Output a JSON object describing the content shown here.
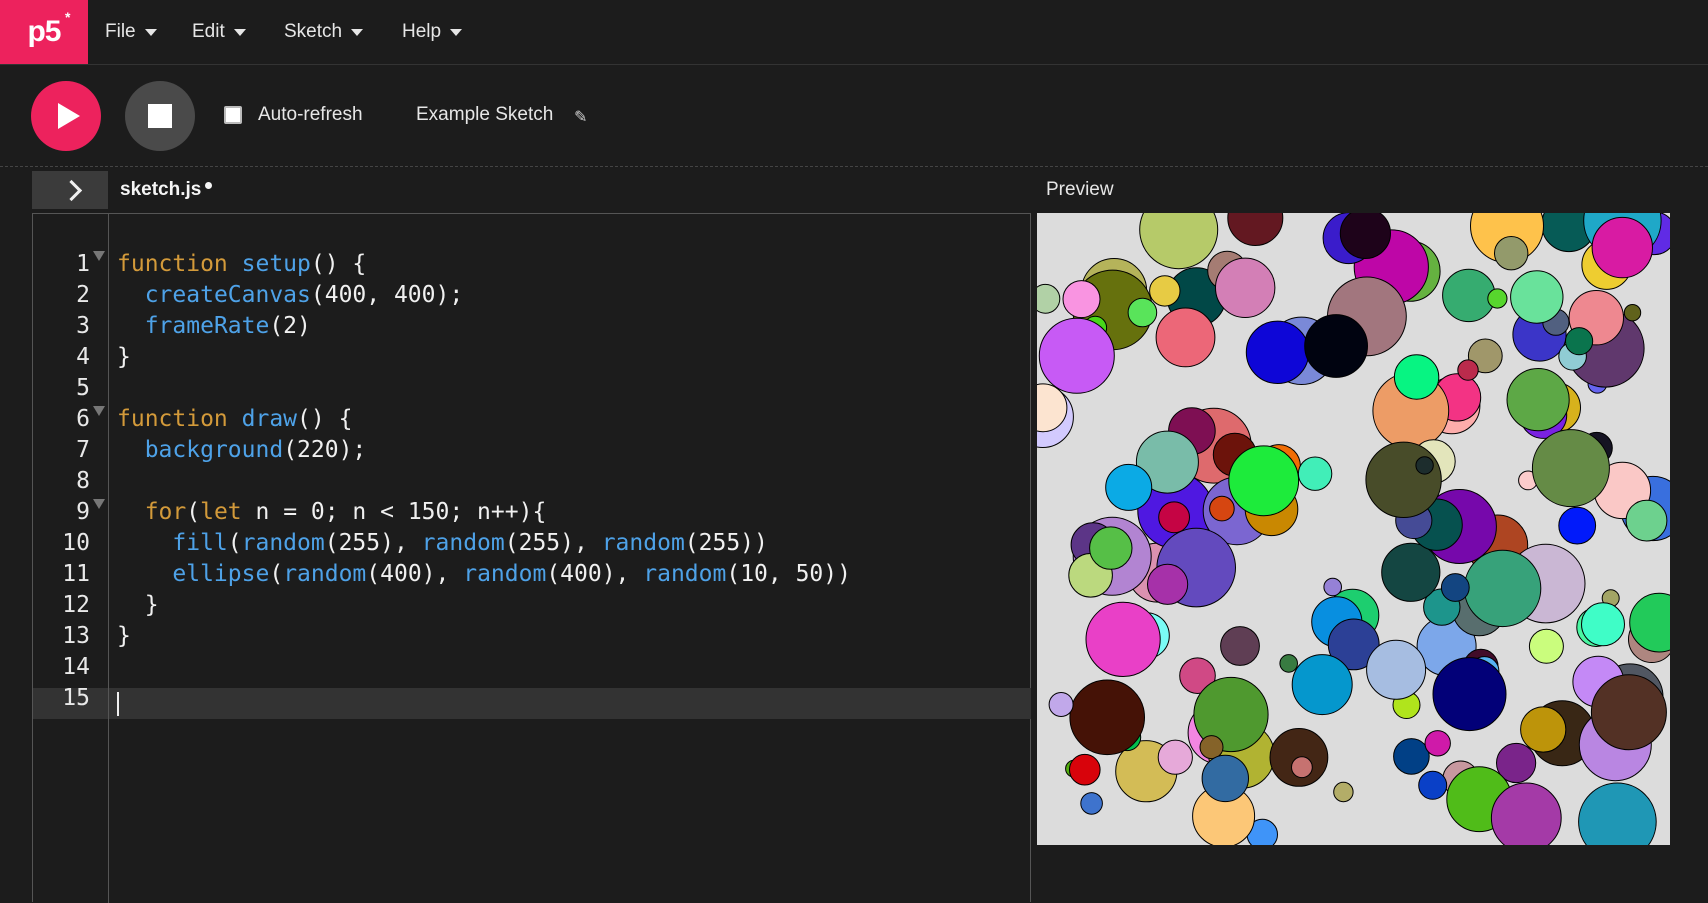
{
  "app": {
    "logo": "p5",
    "logo_mark": "*"
  },
  "menu": [
    {
      "label": "File"
    },
    {
      "label": "Edit"
    },
    {
      "label": "Sketch"
    },
    {
      "label": "Help"
    }
  ],
  "toolbar": {
    "play_icon": "play-icon",
    "stop_icon": "stop-icon",
    "auto_refresh_label": "Auto-refresh",
    "auto_refresh_checked": false,
    "sketch_name": "Example Sketch",
    "edit_icon": "pencil-icon"
  },
  "tabs": {
    "file_name": "sketch.js",
    "unsaved": true
  },
  "preview": {
    "label": "Preview",
    "canvas_background": "#dcdcdc"
  },
  "editor": {
    "active_line": 15,
    "lines": [
      {
        "n": "1",
        "fold": true,
        "code": "function setup() {"
      },
      {
        "n": "2",
        "fold": false,
        "code": "  createCanvas(400, 400);"
      },
      {
        "n": "3",
        "fold": false,
        "code": "  frameRate(2)"
      },
      {
        "n": "4",
        "fold": false,
        "code": "}"
      },
      {
        "n": "5",
        "fold": false,
        "code": ""
      },
      {
        "n": "6",
        "fold": true,
        "code": "function draw() {"
      },
      {
        "n": "7",
        "fold": false,
        "code": "  background(220);"
      },
      {
        "n": "8",
        "fold": false,
        "code": ""
      },
      {
        "n": "9",
        "fold": true,
        "code": "  for(let n = 0; n < 150; n++){"
      },
      {
        "n": "10",
        "fold": false,
        "code": "    fill(random(255), random(255), random(255))"
      },
      {
        "n": "11",
        "fold": false,
        "code": "    ellipse(random(400), random(400), random(10, 50))"
      },
      {
        "n": "12",
        "fold": false,
        "code": "  }"
      },
      {
        "n": "13",
        "fold": false,
        "code": "}"
      },
      {
        "n": "14",
        "fold": false,
        "code": ""
      },
      {
        "n": "15",
        "fold": false,
        "code": ""
      }
    ]
  },
  "colors": {
    "accent": "#ed225d",
    "keyword": "#d39a3a",
    "function": "#4ea2e8",
    "background": "#1c1c1c"
  }
}
